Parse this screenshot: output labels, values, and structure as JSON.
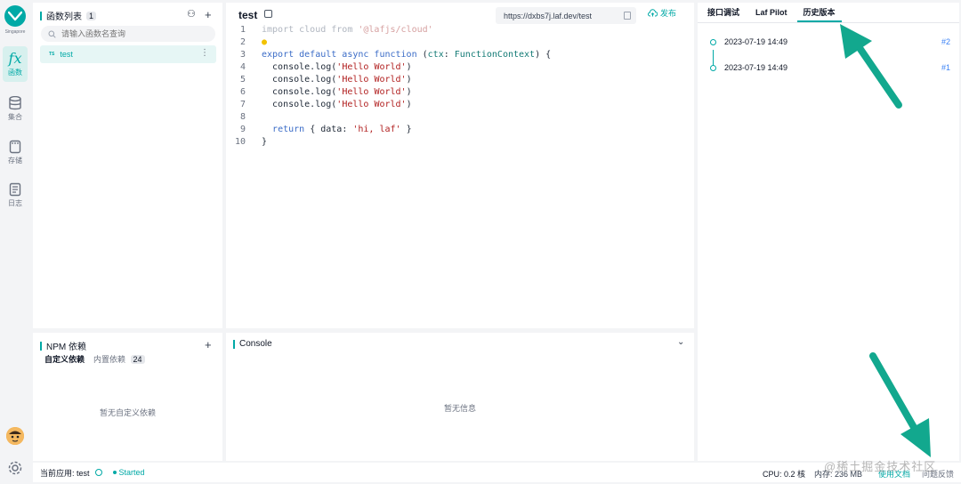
{
  "rail": {
    "region": "Singapore",
    "items": [
      {
        "label": "函数",
        "icon": "function-fx-icon"
      },
      {
        "label": "集合",
        "icon": "database-icon"
      },
      {
        "label": "存储",
        "icon": "storage-icon"
      },
      {
        "label": "日志",
        "icon": "log-icon"
      }
    ]
  },
  "function_list": {
    "title": "函数列表",
    "count": "1",
    "search_placeholder": "请输入函数名查询",
    "items": [
      {
        "tag": "TS",
        "name": "test"
      }
    ]
  },
  "npm": {
    "title": "NPM 依赖",
    "tabs": [
      {
        "label": "自定义依赖"
      },
      {
        "label": "内置依赖",
        "count": "24"
      }
    ],
    "empty": "暂无自定义依赖"
  },
  "editor": {
    "title": "test",
    "url": "https://dxbs7j.laf.dev/test",
    "publish_label": "发布",
    "code_lines": [
      {
        "n": "1",
        "text": "import cloud from '@lafjs/cloud'"
      },
      {
        "n": "2",
        "text": ""
      },
      {
        "n": "3",
        "text": "export default async function (ctx: FunctionContext) {"
      },
      {
        "n": "4",
        "text": "  console.log('Hello World')"
      },
      {
        "n": "5",
        "text": "  console.log('Hello World')"
      },
      {
        "n": "6",
        "text": "  console.log('Hello World')"
      },
      {
        "n": "7",
        "text": "  console.log('Hello World')"
      },
      {
        "n": "8",
        "text": ""
      },
      {
        "n": "9",
        "text": "  return { data: 'hi, laf' }"
      },
      {
        "n": "10",
        "text": "}"
      }
    ]
  },
  "console": {
    "title": "Console",
    "empty": "暂无信息"
  },
  "history": {
    "tabs": [
      "接口调试",
      "Laf Pilot",
      "历史版本"
    ],
    "active_tab": "历史版本",
    "versions": [
      {
        "time": "2023-07-19 14:49",
        "num": "#2"
      },
      {
        "time": "2023-07-19 14:49",
        "num": "#1"
      }
    ]
  },
  "status": {
    "app": "当前应用: test",
    "state": "Started",
    "cpu": "CPU: 0.2 核",
    "memory": "内存: 236 MB",
    "link1": "使用文档",
    "link2": "问题反馈"
  },
  "watermark": "@稀土掘金技术社区",
  "colors": {
    "accent": "#00a9a6",
    "arrow": "#12a88e"
  }
}
